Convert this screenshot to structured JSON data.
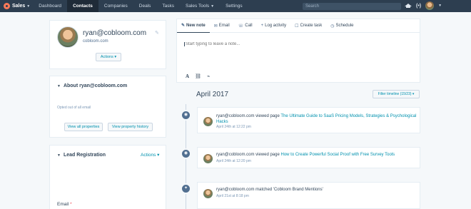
{
  "nav": {
    "brand": "Sales",
    "items": [
      "Dashboard",
      "Contacts",
      "Companies",
      "Deals",
      "Tasks",
      "Sales Tools",
      "Settings"
    ],
    "active": "Contacts",
    "search_placeholder": "Search"
  },
  "profile": {
    "name": "ryan@cobloom.com",
    "domain": "cobloom.com",
    "actions_label": "Actions"
  },
  "about": {
    "title": "About ryan@cobloom.com",
    "opted_out": "Opted out of all email",
    "view_all": "View all properties",
    "view_history": "View property history"
  },
  "lead": {
    "title": "Lead Registration",
    "actions_label": "Actions",
    "email_label": "Email",
    "required_mark": "*"
  },
  "composer": {
    "tabs": [
      {
        "label": "New note",
        "icon": "✎"
      },
      {
        "label": "Email",
        "icon": "✉"
      },
      {
        "label": "Call",
        "icon": "☏"
      },
      {
        "label": "Log activity",
        "icon": "+"
      },
      {
        "label": "Create task",
        "icon": "☐"
      },
      {
        "label": "Schedule",
        "icon": "◷"
      }
    ],
    "placeholder": "Start typing to leave a note..."
  },
  "timeline": {
    "month": "April 2017",
    "filter_label": "Filter timeline (15/23)",
    "events": [
      {
        "who": "ryan@cobloom.com",
        "action": " viewed page ",
        "link": "The Ultimate Guide to SaaS Pricing Models, Strategies & Psychological Hacks",
        "time": "April 24th at 12:22 pm",
        "icon": "eye"
      },
      {
        "who": "ryan@cobloom.com",
        "action": " viewed page ",
        "link": "How to Create Powerful Social Proof with Free Survey Tools",
        "time": "April 24th at 12:20 pm",
        "icon": "eye"
      },
      {
        "who": "ryan@cobloom.com",
        "action": " matched 'Cobloom Brand Mentions'",
        "link": "",
        "time": "April 21st at 8:18 pm",
        "icon": "twitter"
      }
    ]
  }
}
